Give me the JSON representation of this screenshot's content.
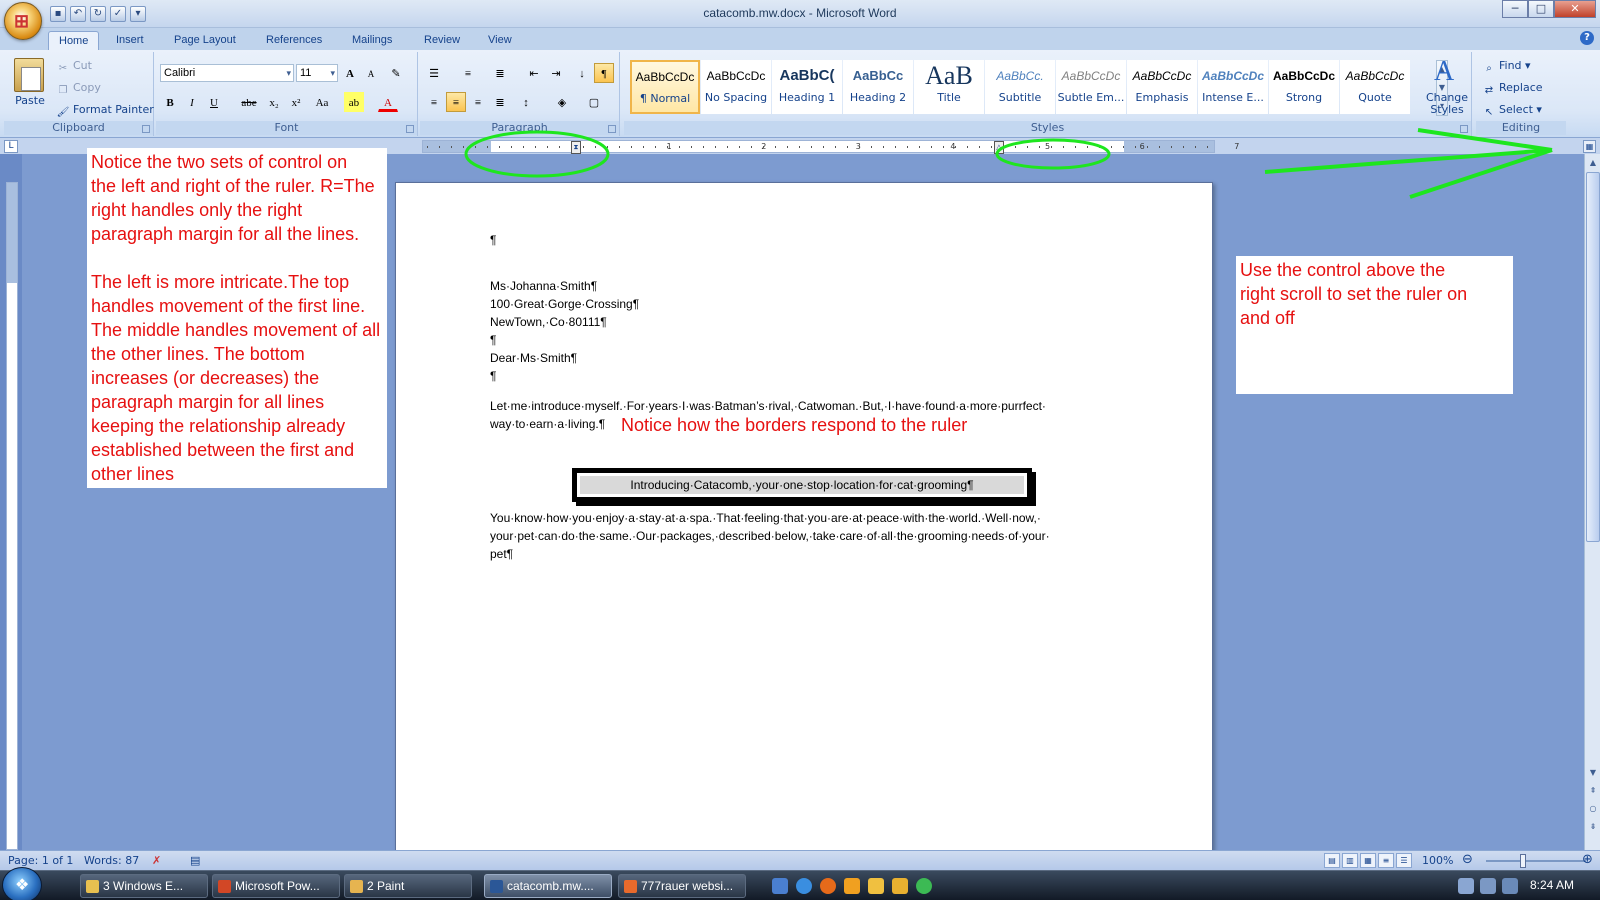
{
  "window": {
    "title": "catacomb.mw.docx - Microsoft Word",
    "minimize": "─",
    "maximize": "□",
    "close": "✕"
  },
  "tabs": [
    {
      "label": "Home"
    },
    {
      "label": "Insert"
    },
    {
      "label": "Page Layout"
    },
    {
      "label": "References"
    },
    {
      "label": "Mailings"
    },
    {
      "label": "Review"
    },
    {
      "label": "View"
    }
  ],
  "ribbon": {
    "clipboard": {
      "label": "Clipboard",
      "paste": "Paste",
      "cut": "Cut",
      "copy": "Copy",
      "format_painter": "Format Painter"
    },
    "font": {
      "label": "Font",
      "font_name": "Calibri",
      "font_size": "11",
      "grow": "A",
      "shrink": "A",
      "clear": "✎",
      "bold": "B",
      "italic": "I",
      "underline": "U",
      "strike": "abe",
      "subscript": "x₂",
      "superscript": "x²",
      "change_case": "Aa",
      "highlight": "ab",
      "font_color": "A"
    },
    "paragraph": {
      "label": "Paragraph",
      "pilcrow": "¶",
      "sort": "↓"
    },
    "styles": {
      "label": "Styles",
      "items": [
        {
          "sample": "AaBbCcDc",
          "name": "¶ Normal"
        },
        {
          "sample": "AaBbCcDc",
          "name": "No Spacing"
        },
        {
          "sample": "AaBbC(",
          "name": "Heading 1"
        },
        {
          "sample": "AaBbCc",
          "name": "Heading 2"
        },
        {
          "sample": "AaB",
          "name": "Title"
        },
        {
          "sample": "AaBbCc.",
          "name": "Subtitle"
        },
        {
          "sample": "AaBbCcDc",
          "name": "Subtle Em..."
        },
        {
          "sample": "AaBbCcDc",
          "name": "Emphasis"
        },
        {
          "sample": "AaBbCcDc",
          "name": "Intense E..."
        },
        {
          "sample": "AaBbCcDc",
          "name": "Strong"
        },
        {
          "sample": "AaBbCcDc",
          "name": "Quote"
        }
      ],
      "change_styles_line1": "Change",
      "change_styles_line2": "Styles"
    },
    "editing": {
      "label": "Editing",
      "find": "Find",
      "replace": "Replace",
      "select": "Select"
    }
  },
  "ruler": {
    "numbers": [
      "1",
      "2",
      "3",
      "4",
      "5",
      "6",
      "7"
    ]
  },
  "document": {
    "lines": [
      "¶",
      "Ms·Johanna·Smith¶",
      "100·Great·Gorge·Crossing¶",
      "NewTown,·Co·80111¶",
      "¶",
      "Dear·Ms·Smith¶",
      "¶",
      "Let·me·introduce·myself.·For·years·I·was·Batman’s·rival,·Catwoman.·But,·I·have·found·a·more·purrfect·",
      "way·to·earn·a·living.¶",
      "You·know·how·you·enjoy·a·stay·at·a·spa.·That·feeling·that·you·are·at·peace·with·the·world.·Well·now,·",
      "your·pet·can·do·the·same.·Our·packages,·described·below,·take·care·of·all·the·grooming·needs·of·your·",
      "pet¶"
    ],
    "bordered_paragraph": "Introducing·Catacomb,·your·one·stop·location·for·cat·grooming¶"
  },
  "annotations": {
    "left_note": [
      "Notice the two sets of control on",
      "the left and right of the ruler. R=The",
      "right handles only the right",
      "paragraph margin for all the lines.",
      "",
      "The left is more intricate.The top",
      "handles movement of the first line.",
      "The middle handles movement of all",
      "the other lines. The bottom",
      "increases (or decreases) the",
      "paragraph margin for all lines",
      "keeping the relationship already",
      "established between the first and",
      "other lines"
    ],
    "right_note": [
      "Use the control above the",
      "right scroll to set the ruler on",
      "and off"
    ],
    "inline_note": "Notice how the borders respond to the ruler",
    "highlight_color": "#1ee61e",
    "text_color": "#e61010"
  },
  "statusbar": {
    "page": "Page: 1 of 1",
    "words": "Words: 87",
    "zoom": "100%"
  },
  "taskbar": {
    "tasks": [
      {
        "label": "3 Windows E..."
      },
      {
        "label": "Microsoft Pow..."
      },
      {
        "label": "2 Paint"
      },
      {
        "label": "catacomb.mw...."
      },
      {
        "label": "777rauer websi..."
      }
    ],
    "clock": "8:24 AM"
  }
}
